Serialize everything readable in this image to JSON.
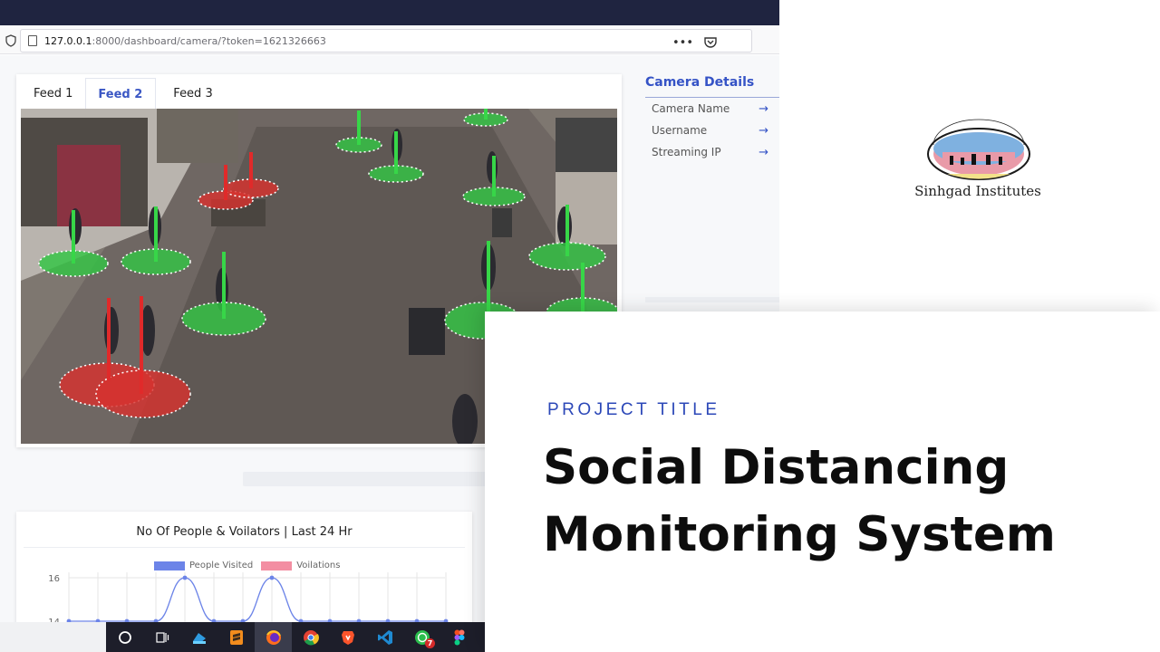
{
  "browser": {
    "url_host": "127.0.0.1",
    "url_rest": ":8000/dashboard/camera/?token=1621326663",
    "menu_dots": "•••"
  },
  "dashboard": {
    "tabs": [
      {
        "label": "Feed 1",
        "active": false
      },
      {
        "label": "Feed 2",
        "active": true
      },
      {
        "label": "Feed 3",
        "active": false
      }
    ],
    "camera_details": {
      "title": "Camera Details",
      "rows": [
        {
          "label": "Camera Name"
        },
        {
          "label": "Username"
        },
        {
          "label": "Streaming IP"
        }
      ]
    },
    "chart": {
      "title": "No Of People & Voilators | Last 24 Hr",
      "legend": [
        {
          "name": "People Visited",
          "color": "#6c84e8"
        },
        {
          "name": "Voilations",
          "color": "#f38ea2"
        }
      ]
    }
  },
  "chart_data": {
    "type": "line",
    "title": "No Of People & Voilators | Last 24 Hr",
    "ytick_labels": [
      "16",
      "14"
    ],
    "series": [
      {
        "name": "People Visited",
        "values": [
          14,
          14,
          14,
          14,
          16,
          14,
          14,
          16,
          14,
          14,
          14,
          14,
          14,
          14
        ]
      },
      {
        "name": "Voilations",
        "values": []
      }
    ]
  },
  "logo": {
    "arc_text": "SINHGAD TECHNICAL EDUCATION SOCIETY, PUNE",
    "motto": "सेवाभावी मा आत्मोत्कर्षः",
    "caption": "Sinhgad Institutes"
  },
  "project": {
    "label": "PROJECT TITLE",
    "title_line1": "Social Distancing",
    "title_line2": "Monitoring System"
  },
  "taskbar": {
    "badge_count": "7",
    "icons": [
      "cortana-icon",
      "task-view-icon",
      "app-icon",
      "sublime-icon",
      "firefox-icon",
      "chrome-icon",
      "brave-icon",
      "vscode-icon",
      "whatsapp-icon",
      "figma-icon"
    ]
  }
}
